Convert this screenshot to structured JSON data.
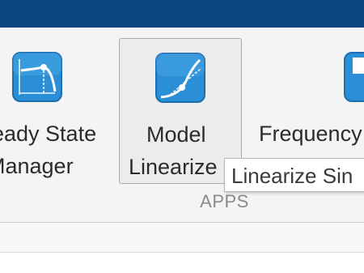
{
  "colors": {
    "titlebar": "#0d4580",
    "ribbon_background": "#f4f4f4",
    "icon_blue": "#2a8fd6",
    "icon_blue_dark": "#1b6fae",
    "group_label": "#8a8a8a"
  },
  "apps": {
    "group_label": "APPS",
    "items": [
      {
        "icon": "steady-state-manager-icon",
        "line1": "eady State",
        "line2": "Manager"
      },
      {
        "icon": "model-linearizer-icon",
        "line1": "Model",
        "line2": "Linearize",
        "selected": true
      },
      {
        "icon": "frequency-response-estimator-icon",
        "line1": "Frequency",
        "line2": ""
      }
    ]
  },
  "tooltip": {
    "text": "Linearize Sin"
  }
}
